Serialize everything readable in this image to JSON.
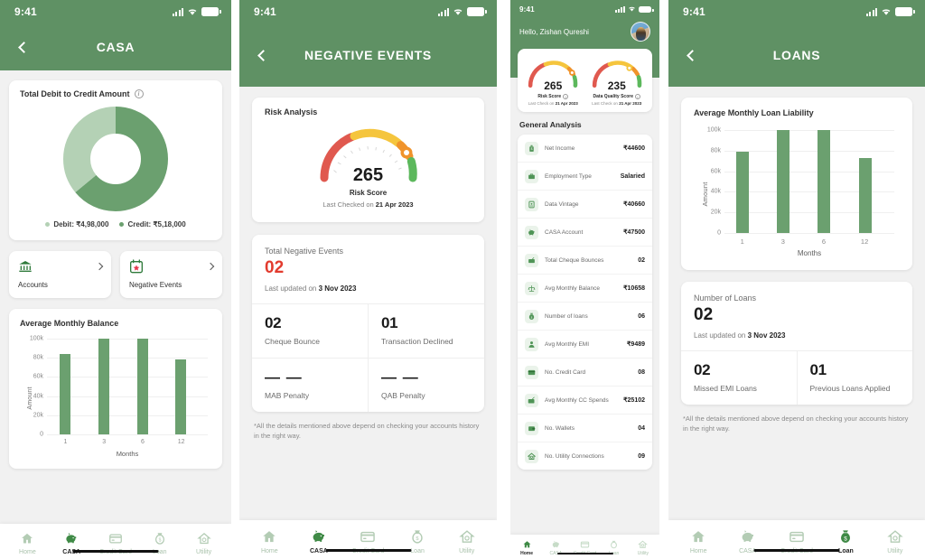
{
  "status_bar": {
    "time": "9:41",
    "icons": [
      "signal-bars",
      "wifi",
      "battery"
    ]
  },
  "colors": {
    "brand_green": "#5f9164",
    "bar_green": "#6ba06f",
    "donut_credit": "#6ba06f",
    "donut_debit": "#b4d1b5",
    "danger_red": "#e23b2e",
    "gauge_red": "#e0594f",
    "gauge_yellow": "#f5c53d",
    "gauge_orange": "#f0932b",
    "gauge_green": "#5cb85c"
  },
  "panel_casa": {
    "header_title": "CASA",
    "back_icon": "chevron-left-icon",
    "donut_card": {
      "title": "Total Debit to Credit Amount",
      "info_icon": "info-icon",
      "legend": [
        {
          "label": "Debit: ₹4,98,000",
          "color": "#b4d1b5"
        },
        {
          "label": "Credit: ₹5,18,000",
          "color": "#6ba06f"
        }
      ]
    },
    "quick_links": [
      {
        "label": "Accounts",
        "icon": "bank-icon"
      },
      {
        "label": "Negative Events",
        "icon": "calendar-alert-icon"
      }
    ],
    "tabs": [
      {
        "label": "Home",
        "icon": "home-icon",
        "active": false
      },
      {
        "label": "CASA",
        "icon": "piggy-bank-icon",
        "active": true
      },
      {
        "label": "Credit Card",
        "icon": "credit-card-icon",
        "active": false
      },
      {
        "label": "Loan",
        "icon": "money-bag-icon",
        "active": false
      },
      {
        "label": "Utility",
        "icon": "utility-house-icon",
        "active": false
      }
    ]
  },
  "panel_negative": {
    "header_title": "NEGATIVE EVENTS",
    "back_icon": "chevron-left-icon",
    "risk_card": {
      "title": "Risk Analysis",
      "score": "265",
      "score_label": "Risk Score",
      "last_checked_prefix": "Last Checked on ",
      "last_checked_date": "21 Apr 2023"
    },
    "events": {
      "caption": "Total Negative Events",
      "total": "02",
      "updated_prefix": "Last updated on ",
      "updated_date": "3 Nov 2023",
      "cells": [
        {
          "value": "02",
          "label": "Cheque Bounce"
        },
        {
          "value": "01",
          "label": "Transaction Declined"
        },
        {
          "value": "—  —",
          "label": "MAB Penalty"
        },
        {
          "value": "—  —",
          "label": "QAB Penalty"
        }
      ]
    },
    "footnote": "*All the details mentioned above depend on checking your accounts history in the right way.",
    "tabs": [
      {
        "label": "Home",
        "icon": "home-icon",
        "active": false
      },
      {
        "label": "CASA",
        "icon": "piggy-bank-icon",
        "active": true
      },
      {
        "label": "Credit Card",
        "icon": "credit-card-icon",
        "active": false
      },
      {
        "label": "Loan",
        "icon": "money-bag-icon",
        "active": false
      },
      {
        "label": "Utility",
        "icon": "utility-house-icon",
        "active": false
      }
    ]
  },
  "panel_home": {
    "greeting": "Hello, Zishan Qureshi",
    "avatar_icon": "user-avatar",
    "gauges": [
      {
        "score": "265",
        "label": "Risk Score",
        "info_icon": "info-icon",
        "sub_prefix": "Last Check on ",
        "sub_date": "21 Apr 2023"
      },
      {
        "score": "235",
        "label": "Data Quality Score",
        "info_icon": "info-icon",
        "sub_prefix": "Last Check on ",
        "sub_date": "21 Apr 2023"
      }
    ],
    "section_title": "General Analysis",
    "rows": [
      {
        "icon": "income-icon",
        "name": "Net Income",
        "value": "₹44600"
      },
      {
        "icon": "briefcase-icon",
        "name": "Employment Type",
        "value": "Salaried"
      },
      {
        "icon": "data-vintage-icon",
        "name": "Data Vintage",
        "value": "₹40660"
      },
      {
        "icon": "piggy-bank-icon",
        "name": "CASA Account",
        "value": "₹47500"
      },
      {
        "icon": "cheque-bounce-icon",
        "name": "Total Cheque Bounces",
        "value": "02"
      },
      {
        "icon": "balance-scale-icon",
        "name": "Avg Monthly Balance",
        "value": "₹10658"
      },
      {
        "icon": "money-bag-icon",
        "name": "Number of loans",
        "value": "06"
      },
      {
        "icon": "emi-person-icon",
        "name": "Avg Monthly EMI",
        "value": "₹9489"
      },
      {
        "icon": "credit-card-icon",
        "name": "No. Credit Card",
        "value": "08"
      },
      {
        "icon": "card-spend-icon",
        "name": "Avg Monthly CC Spends",
        "value": "₹25102"
      },
      {
        "icon": "wallet-icon",
        "name": "No. Wallets",
        "value": "04"
      },
      {
        "icon": "utility-house-icon",
        "name": "No. Utility Connections",
        "value": "09"
      }
    ],
    "tabs": [
      {
        "label": "Home",
        "icon": "home-icon",
        "active": true
      },
      {
        "label": "CASA",
        "icon": "piggy-bank-icon",
        "active": false
      },
      {
        "label": "Credit Card",
        "icon": "credit-card-icon",
        "active": false
      },
      {
        "label": "Loan",
        "icon": "money-bag-icon",
        "active": false
      },
      {
        "label": "Utility",
        "icon": "utility-house-icon",
        "active": false
      }
    ]
  },
  "panel_loans": {
    "header_title": "LOANS",
    "back_icon": "chevron-left-icon",
    "loans": {
      "caption": "Number of Loans",
      "total": "02",
      "updated_prefix": "Last updated on ",
      "updated_date": "3 Nov 2023",
      "cells": [
        {
          "value": "02",
          "label": "Missed EMI Loans",
          "highlight": true
        },
        {
          "value": "01",
          "label": "Previous Loans Applied",
          "highlight": false
        }
      ]
    },
    "footnote": "*All the details mentioned above depend on checking your accounts history in the right way.",
    "tabs": [
      {
        "label": "Home",
        "icon": "home-icon",
        "active": false
      },
      {
        "label": "CASA",
        "icon": "piggy-bank-icon",
        "active": false
      },
      {
        "label": "Credit Card",
        "icon": "credit-card-icon",
        "active": false
      },
      {
        "label": "Loan",
        "icon": "money-bag-icon",
        "active": true
      },
      {
        "label": "Utility",
        "icon": "utility-house-icon",
        "active": false
      }
    ]
  },
  "chart_data": [
    {
      "type": "pie",
      "title": "Total Debit to Credit Amount",
      "labels": [
        "Debit",
        "Credit"
      ],
      "values": [
        498000,
        518000
      ],
      "value_labels": [
        "₹4,98,000",
        "₹5,18,000"
      ],
      "colors": [
        "#b4d1b5",
        "#6ba06f"
      ],
      "donut": true,
      "legend_position": "bottom"
    },
    {
      "type": "bar",
      "title": "Average Monthly Balance",
      "categories": [
        "1",
        "3",
        "6",
        "12"
      ],
      "values": [
        79000,
        100000,
        100000,
        74000
      ],
      "xlabel": "Months",
      "ylabel": "Amount",
      "ylim": [
        0,
        100000
      ],
      "yticks": [
        0,
        20000,
        40000,
        60000,
        80000,
        100000
      ],
      "ytick_labels": [
        "0",
        "20k",
        "40k",
        "60k",
        "80k",
        "100k"
      ],
      "grid": true,
      "legend_position": "none"
    },
    {
      "type": "bar",
      "title": "Average Monthly Loan Liability",
      "categories": [
        "1",
        "3",
        "6",
        "12"
      ],
      "values": [
        79000,
        100000,
        100000,
        74000
      ],
      "xlabel": "Months",
      "ylabel": "Amount",
      "ylim": [
        0,
        100000
      ],
      "yticks": [
        0,
        20000,
        40000,
        60000,
        80000,
        100000
      ],
      "ytick_labels": [
        "0",
        "20k",
        "40k",
        "60k",
        "80k",
        "100k"
      ],
      "grid": true,
      "legend_position": "none"
    },
    {
      "type": "gauge",
      "title": "Risk Analysis",
      "value": 265,
      "label": "Risk Score",
      "annotation": "Last Checked on 21 Apr 2023",
      "segments": [
        {
          "color": "#e0594f",
          "span": "0-45%"
        },
        {
          "color": "#f5c53d",
          "span": "45-75%"
        },
        {
          "color": "#f0932b",
          "span": "75-85%"
        },
        {
          "color": "#5cb85c",
          "span": "85-100%"
        }
      ]
    },
    {
      "type": "gauge",
      "title": "Data Quality Score",
      "value": 235,
      "label": "Data Quality Score",
      "annotation": "Last Check on 21 Apr 2023",
      "segments": [
        {
          "color": "#e0594f",
          "span": "0-45%"
        },
        {
          "color": "#f5c53d",
          "span": "45-75%"
        },
        {
          "color": "#f0932b",
          "span": "75-85%"
        },
        {
          "color": "#5cb85c",
          "span": "85-100%"
        }
      ]
    }
  ]
}
